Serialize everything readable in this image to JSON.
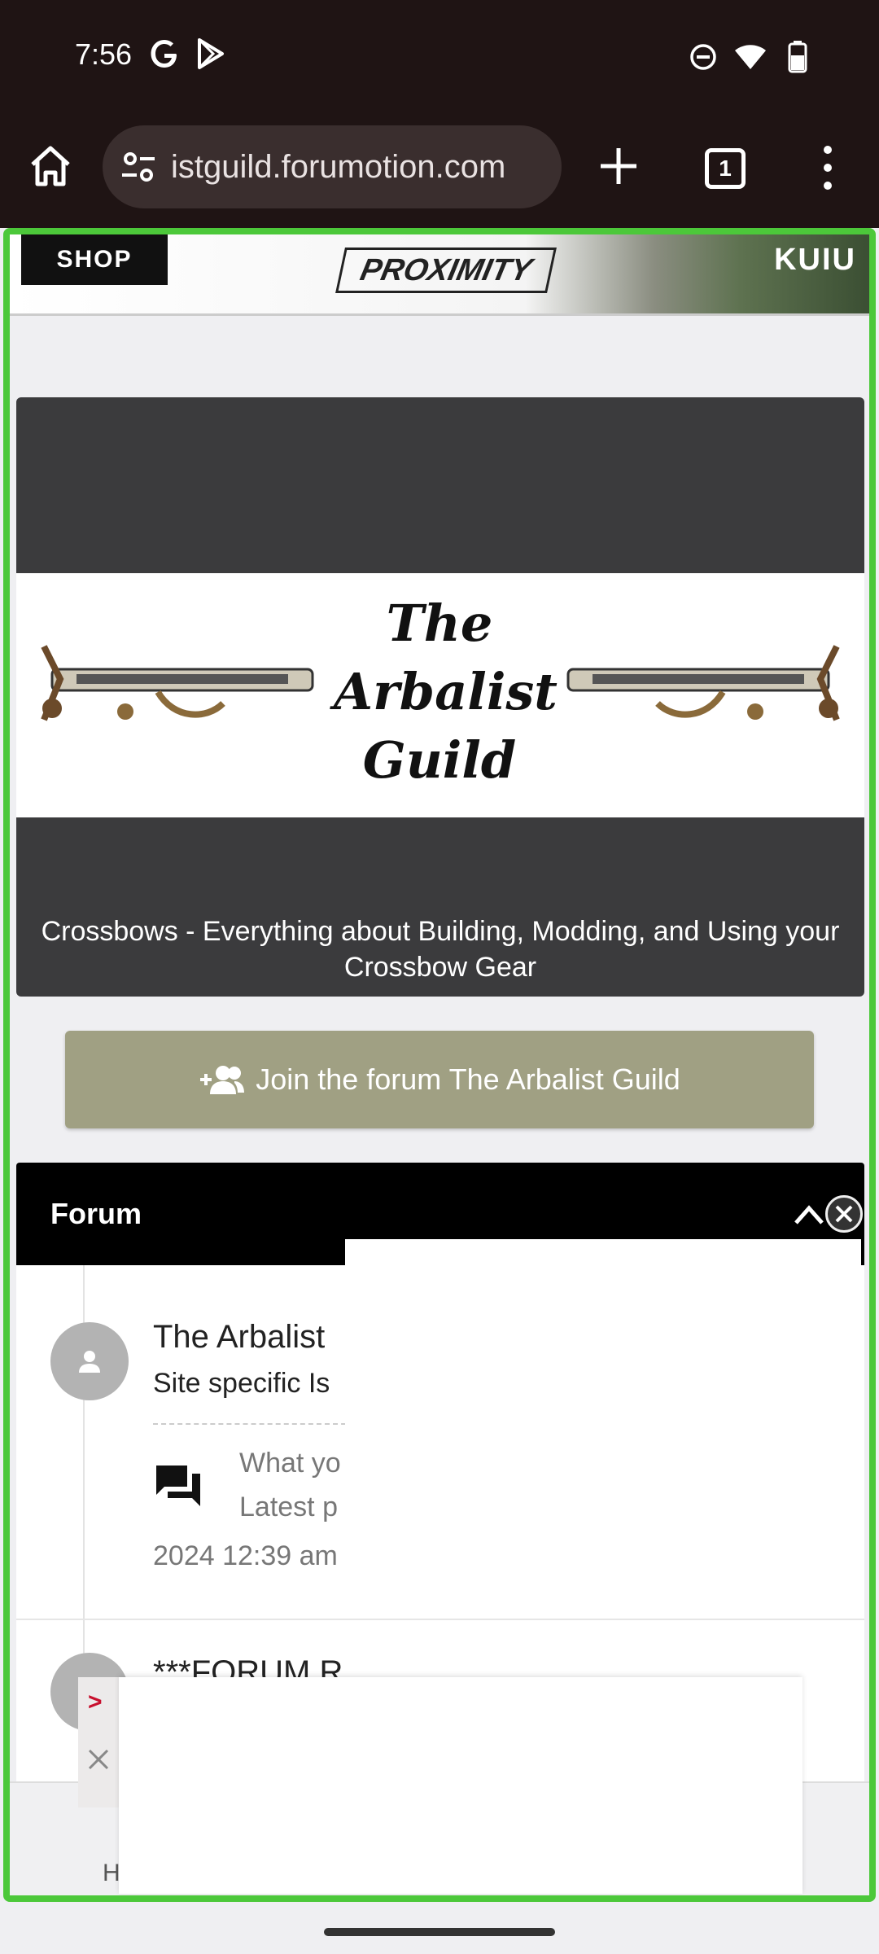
{
  "status_bar": {
    "time": "7:56",
    "left_icons": [
      "google-g-icon",
      "play-store-icon"
    ],
    "right_icons": [
      "do-not-disturb-icon",
      "wifi-icon",
      "battery-icon"
    ]
  },
  "browser": {
    "url": "istguild.forumotion.com",
    "tab_count": "1"
  },
  "banner": {
    "shop_label": "SHOP",
    "proximity_label": "PROXIMITY",
    "kuiu_label": "KUIU"
  },
  "header": {
    "logo_line1": "The",
    "logo_line2": "Arbalist",
    "logo_line3": "Guild",
    "tagline": "Crossbows - Everything about Building, Modding, and Using your Crossbow Gear"
  },
  "join_button": {
    "label": "Join the forum The Arbalist Guild"
  },
  "forum": {
    "header_title": "Forum",
    "rows": [
      {
        "title": "The Arbalist",
        "description": "Site specific Is",
        "last_post_line1": "What yo",
        "last_post_line2": "Latest p",
        "date": "2024 12:39 am"
      },
      {
        "title": "***FORUM R"
      }
    ]
  },
  "bottom_bar": {
    "text": "H"
  },
  "colors": {
    "status_bg": "#1f1414",
    "join_button": "#a0a083",
    "forum_header": "#000000",
    "highlight_frame": "#4cc83a",
    "header_card": "#3b3b3d"
  }
}
